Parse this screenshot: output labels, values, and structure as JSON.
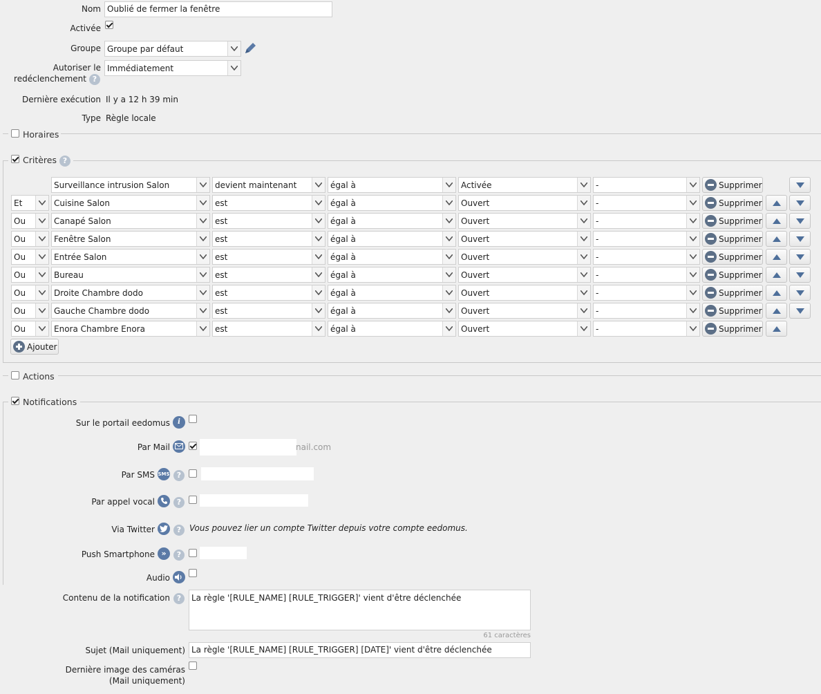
{
  "general": {
    "name_label": "Nom",
    "name_value": "Oublié de fermer la fenêtre",
    "enabled_label": "Activée",
    "group_label": "Groupe",
    "group_value": "Groupe par défaut",
    "retrigger_label_line1": "Autoriser le",
    "retrigger_label_line2": "redéclenchement",
    "retrigger_value": "Immédiatement",
    "last_run_label": "Dernière exécution",
    "last_run_value": "Il y a 12 h 39 min",
    "type_label": "Type",
    "type_value": "Règle locale"
  },
  "sections": {
    "schedules": "Horaires",
    "criteria": "Critères",
    "actions": "Actions",
    "notifications": "Notifications"
  },
  "criteria": {
    "rows": [
      {
        "conj": "",
        "device": "Surveillance intrusion Salon",
        "verb": "devient maintenant",
        "op": "égal à",
        "value": "Activée",
        "extra": "-",
        "delete": "Supprimer",
        "up": false,
        "down": true
      },
      {
        "conj": "Et",
        "device": "Cuisine Salon",
        "verb": "est",
        "op": "égal à",
        "value": "Ouvert",
        "extra": "-",
        "delete": "Supprimer",
        "up": true,
        "down": true
      },
      {
        "conj": "Ou",
        "device": "Canapé Salon",
        "verb": "est",
        "op": "égal à",
        "value": "Ouvert",
        "extra": "-",
        "delete": "Supprimer",
        "up": true,
        "down": true
      },
      {
        "conj": "Ou",
        "device": "Fenêtre Salon",
        "verb": "est",
        "op": "égal à",
        "value": "Ouvert",
        "extra": "-",
        "delete": "Supprimer",
        "up": true,
        "down": true
      },
      {
        "conj": "Ou",
        "device": "Entrée Salon",
        "verb": "est",
        "op": "égal à",
        "value": "Ouvert",
        "extra": "-",
        "delete": "Supprimer",
        "up": true,
        "down": true
      },
      {
        "conj": "Ou",
        "device": "Bureau",
        "verb": "est",
        "op": "égal à",
        "value": "Ouvert",
        "extra": "-",
        "delete": "Supprimer",
        "up": true,
        "down": true
      },
      {
        "conj": "Ou",
        "device": "Droite Chambre dodo",
        "verb": "est",
        "op": "égal à",
        "value": "Ouvert",
        "extra": "-",
        "delete": "Supprimer",
        "up": true,
        "down": true
      },
      {
        "conj": "Ou",
        "device": "Gauche Chambre dodo",
        "verb": "est",
        "op": "égal à",
        "value": "Ouvert",
        "extra": "-",
        "delete": "Supprimer",
        "up": true,
        "down": true
      },
      {
        "conj": "Ou",
        "device": "Enora Chambre Enora",
        "verb": "est",
        "op": "égal à",
        "value": "Ouvert",
        "extra": "-",
        "delete": "Supprimer",
        "up": true,
        "down": false
      }
    ],
    "add_label": "Ajouter"
  },
  "notifications": {
    "portal_label": "Sur le portail eedomus",
    "mail_label": "Par Mail",
    "mail_value_suffix": "nail.com",
    "sms_label": "Par SMS",
    "sms_icon_text": "SMS",
    "voice_label": "Par appel vocal",
    "twitter_label": "Via Twitter",
    "twitter_note": "Vous pouvez lier un compte Twitter depuis votre compte eedomus.",
    "push_label": "Push Smartphone",
    "audio_label": "Audio",
    "content_label": "Contenu de la notification",
    "content_value": "La règle '[RULE_NAME] [RULE_TRIGGER]' vient d'être déclenchée",
    "content_counter": "61 caractères",
    "subject_label": "Sujet (Mail uniquement)",
    "subject_value": "La règle '[RULE_NAME] [RULE_TRIGGER] [DATE]' vient d'être déclenchée",
    "camera_label_line1": "Dernière image des caméras",
    "camera_label_line2": "(Mail uniquement)"
  }
}
